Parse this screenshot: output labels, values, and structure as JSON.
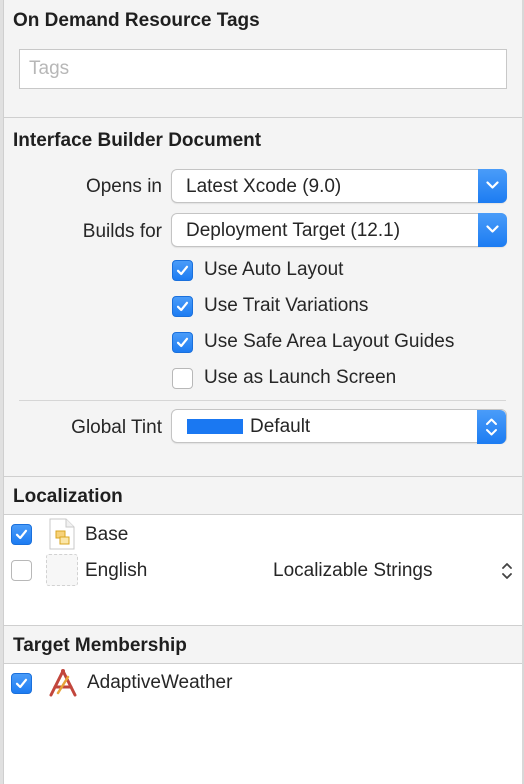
{
  "odr": {
    "title": "On Demand Resource Tags",
    "tags_placeholder": "Tags",
    "tags_value": ""
  },
  "ib": {
    "title": "Interface Builder Document",
    "opens_in_label": "Opens in",
    "opens_in_value": "Latest Xcode (9.0)",
    "builds_for_label": "Builds for",
    "builds_for_value": "Deployment Target (12.1)",
    "options": [
      {
        "label": "Use Auto Layout",
        "checked": true
      },
      {
        "label": "Use Trait Variations",
        "checked": true
      },
      {
        "label": "Use Safe Area Layout Guides",
        "checked": true
      },
      {
        "label": "Use as Launch Screen",
        "checked": false
      }
    ],
    "global_tint_label": "Global Tint",
    "global_tint_value": "Default",
    "global_tint_color": "#1a78f2"
  },
  "localization": {
    "title": "Localization",
    "items": [
      {
        "label": "Base",
        "checked": true,
        "icon": "storyboard-file-icon",
        "type": ""
      },
      {
        "label": "English",
        "checked": false,
        "icon": "blank-file-icon",
        "type": "Localizable Strings"
      }
    ]
  },
  "target_membership": {
    "title": "Target Membership",
    "items": [
      {
        "label": "AdaptiveWeather",
        "checked": true,
        "icon": "app-target-icon"
      }
    ]
  },
  "colors": {
    "accent": "#1c7cf2",
    "panel_bg": "#f4f4f4"
  }
}
